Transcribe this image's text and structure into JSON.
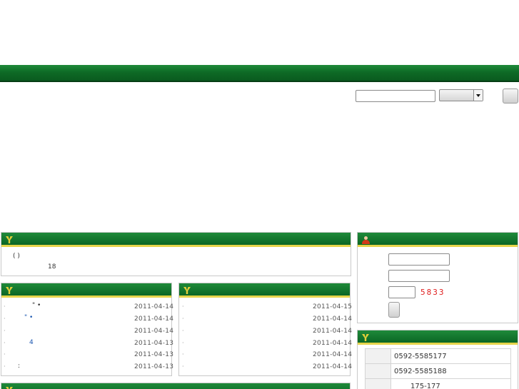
{
  "intro": {
    "paren": "( )",
    "number": "18"
  },
  "news_left": [
    {
      "title": "\"  •",
      "date": "2011-04-14"
    },
    {
      "title": "\"  •",
      "date": "2011-04-14"
    },
    {
      "title": "",
      "date": "2011-04-14"
    },
    {
      "title": "4",
      "date": "2011-04-13"
    },
    {
      "title": "",
      "date": "2011-04-13"
    },
    {
      "title": ":",
      "date": "2011-04-13"
    }
  ],
  "news_right": [
    {
      "date": "2011-04-15"
    },
    {
      "date": "2011-04-14"
    },
    {
      "date": "2011-04-14"
    },
    {
      "date": "2011-04-14"
    },
    {
      "date": "2011-04-14"
    },
    {
      "date": "2011-04-14"
    }
  ],
  "login": {
    "captcha": "5833"
  },
  "contact": {
    "phone": "0592-5585177",
    "fax": "0592-5585188",
    "address": "175-177"
  },
  "colors": {
    "header_green": "#0e6b26",
    "underline_yellow": "#e6d44a",
    "captcha_red": "#e02020"
  },
  "icons": {
    "panel": "y-logo-icon",
    "login": "user-icon",
    "select": "chevron-down-icon"
  }
}
